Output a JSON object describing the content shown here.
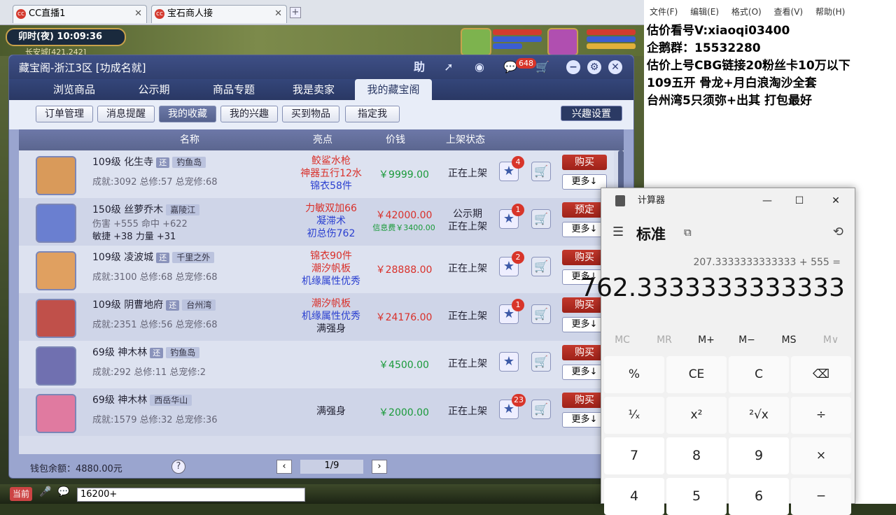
{
  "browser": {
    "tabs": [
      {
        "label": "CC直播1",
        "icon": "cc-icon"
      },
      {
        "label": "宝石商人接",
        "icon": "cc-icon"
      }
    ]
  },
  "game": {
    "clock": "卯时(夜)  10:09:36",
    "location": "长安城[421,242]",
    "window": {
      "title": "藏宝阁-浙江3区 [功成名就]",
      "help_btn": "助",
      "notif_count": "648",
      "nav_tabs": [
        "浏览商品",
        "公示期",
        "商品专题",
        "我是卖家",
        "我的藏宝阁"
      ],
      "subtabs": [
        "订单管理",
        "消息提醒",
        "我的收藏",
        "我的兴趣",
        "买到物品",
        "指定我"
      ],
      "interest_settings": "兴趣设置",
      "columns": {
        "name": "名称",
        "highlight": "亮点",
        "price": "价钱",
        "status": "上架状态"
      },
      "rows": [
        {
          "level": "109级",
          "school": "化生寺",
          "tag": "还",
          "server": "钓鱼岛",
          "stats": "成就:3092 总修:57 总宠修:68",
          "hl": [
            "鲛鲨水枪",
            "神器五行12水",
            "锦衣58件"
          ],
          "hl_colors": [
            "#d9302a",
            "#d9302a",
            "#2a3fd0"
          ],
          "price": "￥9999.00",
          "price_color": "#1a9a3a",
          "fee": "",
          "status": [
            "正在上架"
          ],
          "favs": "4",
          "action": "购买",
          "more": "更多↓"
        },
        {
          "level": "150级",
          "school": "丝萝乔木",
          "tag": "",
          "server": "嘉陵江",
          "stats": "伤害 +555 命中 +622",
          "stats2": "敏捷 +38 力量 +31",
          "hl": [
            "力敏双加66",
            "凝滞术",
            "初总伤762"
          ],
          "hl_colors": [
            "#d9302a",
            "#2a3fd0",
            "#2a3fd0"
          ],
          "price": "￥42000.00",
          "price_color": "#d9302a",
          "fee": "信息费￥3400.00",
          "status": [
            "公示期",
            "正在上架"
          ],
          "favs": "1",
          "action": "预定",
          "more": "更多↓"
        },
        {
          "level": "109级",
          "school": "凌波城",
          "tag": "还",
          "server": "千里之外",
          "stats": "成就:3100 总修:68 总宠修:68",
          "hl": [
            "锦衣90件",
            "潮汐帆板",
            "机缘属性优秀"
          ],
          "hl_colors": [
            "#d9302a",
            "#d9302a",
            "#2a3fd0"
          ],
          "price": "￥28888.00",
          "price_color": "#d9302a",
          "fee": "",
          "status": [
            "正在上架"
          ],
          "favs": "2",
          "action": "购买",
          "more": "更多↓"
        },
        {
          "level": "109级",
          "school": "阴曹地府",
          "tag": "还",
          "server": "台州湾",
          "stats": "成就:2351 总修:56 总宠修:68",
          "hl": [
            "潮汐帆板",
            "机缘属性优秀",
            "满强身"
          ],
          "hl_colors": [
            "#d9302a",
            "#2a3fd0",
            "#223"
          ],
          "price": "￥24176.00",
          "price_color": "#d9302a",
          "fee": "",
          "status": [
            "正在上架"
          ],
          "favs": "1",
          "action": "购买",
          "more": "更多↓"
        },
        {
          "level": "69级",
          "school": "神木林",
          "tag": "还",
          "server": "钓鱼岛",
          "stats": "成就:292 总修:11 总宠修:2",
          "hl": [],
          "hl_colors": [],
          "price": "￥4500.00",
          "price_color": "#1a9a3a",
          "fee": "",
          "status": [
            "正在上架"
          ],
          "favs": "",
          "action": "购买",
          "more": "更多↓"
        },
        {
          "level": "69级",
          "school": "神木林",
          "tag": "",
          "server": "西岳华山",
          "stats": "成就:1579 总修:32 总宠修:36",
          "hl": [
            "满强身"
          ],
          "hl_colors": [
            "#223"
          ],
          "price": "￥2000.00",
          "price_color": "#1a9a3a",
          "fee": "",
          "status": [
            "正在上架"
          ],
          "favs": "23",
          "action": "购买",
          "more": "更多↓"
        }
      ],
      "wallet": "钱包余额：4880.00元",
      "page": "1/9"
    },
    "chat": {
      "channel": "当前",
      "input": "16200+"
    }
  },
  "notepad": {
    "menu": [
      "文件(F)",
      "编辑(E)",
      "格式(O)",
      "查看(V)",
      "帮助(H)"
    ],
    "lines": [
      "估价看号V:xiaoqi03400",
      "企鹅群：15532280",
      "估价上号CBG链接20粉丝卡10万以下",
      "109五开 骨龙+月白浪淘沙全套",
      "台州湾5只须弥+出其 打包最好"
    ]
  },
  "calculator": {
    "title": "计算器",
    "mode": "标准",
    "expression": "207.3333333333333 + 555 =",
    "result": "762.3333333333333",
    "memory": [
      "MC",
      "MR",
      "M+",
      "M−",
      "MS",
      "M∨"
    ],
    "keys": [
      "%",
      "CE",
      "C",
      "⌫",
      "¹⁄ₓ",
      "x²",
      "²√x",
      "÷",
      "7",
      "8",
      "9",
      "×",
      "4",
      "5",
      "6",
      "−"
    ]
  }
}
